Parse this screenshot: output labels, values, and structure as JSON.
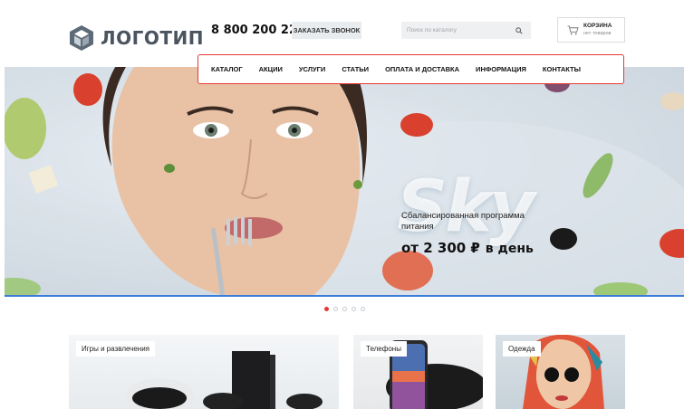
{
  "header": {
    "logo_text": "ЛОГОТИП",
    "phone": "8 800 200 2222",
    "callback_label": "ЗАКАЗАТЬ ЗВОНОК",
    "search_placeholder": "Поиск по каталогу",
    "cart_title": "КОРЗИНА",
    "cart_subtitle": "нет товаров"
  },
  "nav": {
    "items": [
      {
        "label": "КАТАЛОГ"
      },
      {
        "label": "АКЦИИ"
      },
      {
        "label": "УСЛУГИ"
      },
      {
        "label": "СТАТЬИ"
      },
      {
        "label": "ОПЛАТА И ДОСТАВКА"
      },
      {
        "label": "ИНФОРМАЦИЯ"
      },
      {
        "label": "КОНТАКТЫ"
      }
    ],
    "highlight_color": "#e53935"
  },
  "hero": {
    "brand": "Sky",
    "subtitle": "Сбалансированная программа питания",
    "price_prefix": "от 2 300 ₽",
    "price_suffix": "в день",
    "accent_line_color": "#3b7dd8"
  },
  "slider": {
    "dot_count": 5,
    "active_index": 0
  },
  "categories": [
    {
      "label": "Игры и развлечения"
    },
    {
      "label": "Телефоны"
    },
    {
      "label": "Одежда"
    }
  ]
}
